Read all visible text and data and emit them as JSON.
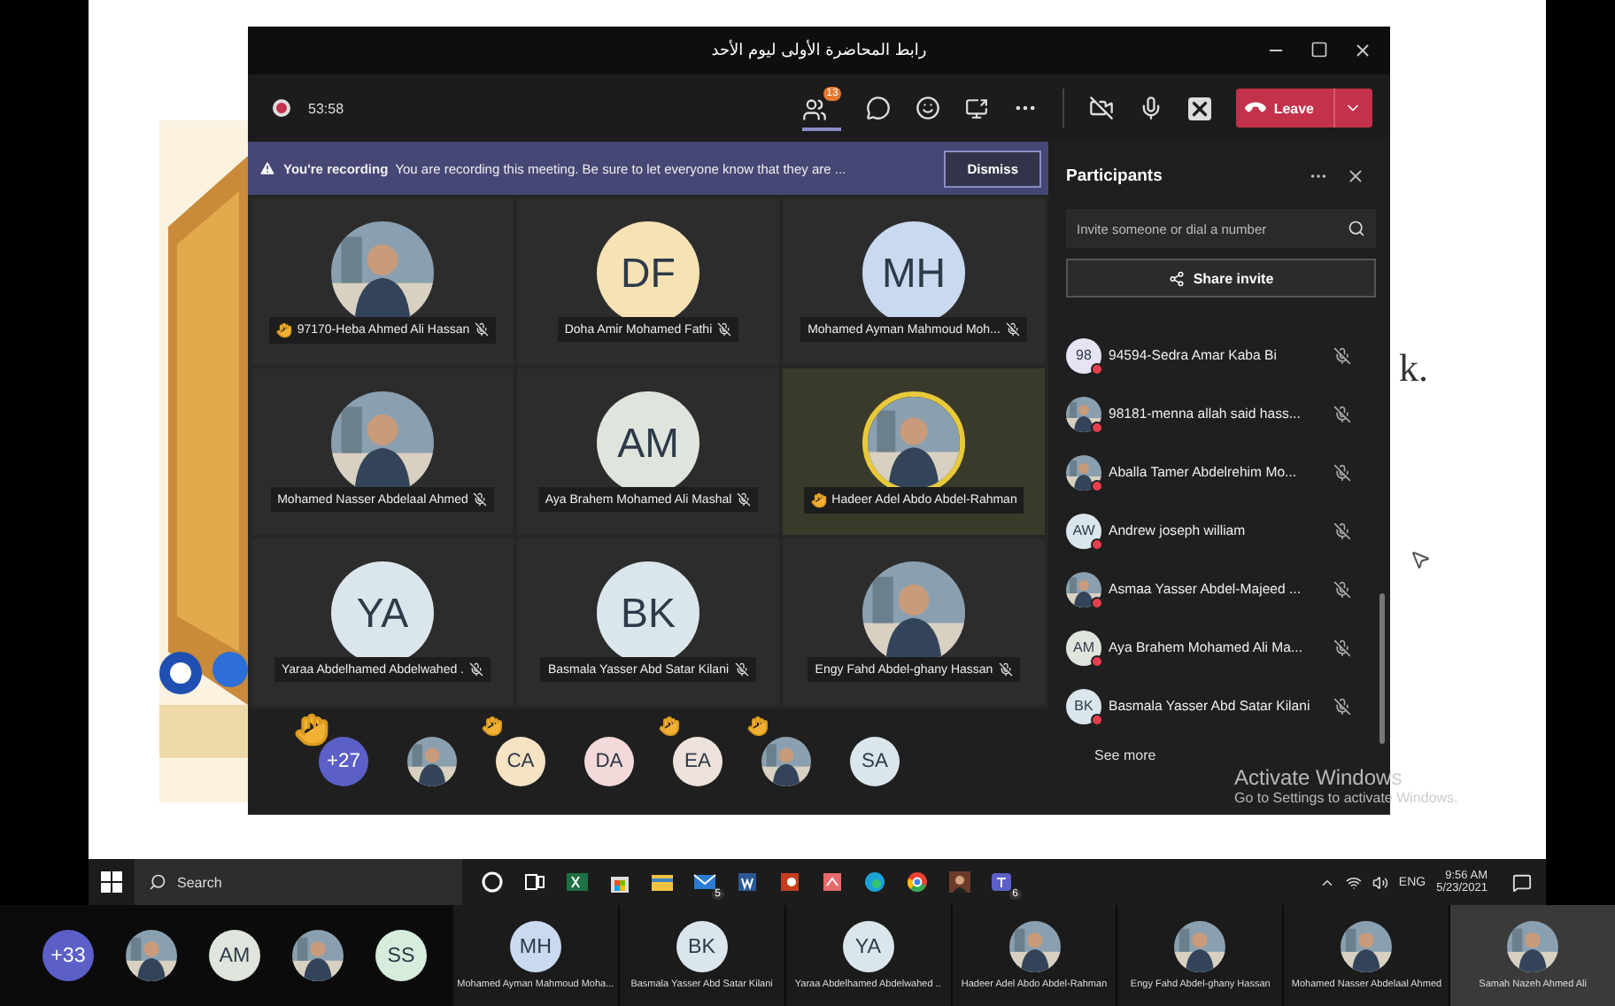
{
  "window": {
    "title": "رابط المحاضرة الأولى ليوم الأحد"
  },
  "meeting_bar": {
    "recording": true,
    "timer": "53:58",
    "participants_badge": "13",
    "camera_on": false,
    "leave_label": "Leave"
  },
  "recording_banner": {
    "title": "You're recording",
    "message": "You are recording this meeting. Be sure to let everyone know that they are ...",
    "dismiss": "Dismiss"
  },
  "tiles": [
    {
      "name": "97170-Heba Ahmed Ali Hassan",
      "kind": "picture",
      "hand_raised": true,
      "speaking": false,
      "muted": true
    },
    {
      "name": "Doha Amir Mohamed Fathi",
      "kind": "initials",
      "initials": "DF",
      "color": "#f6e2b3",
      "hand_raised": false,
      "speaking": false,
      "muted": true
    },
    {
      "name": "Mohamed Ayman Mahmoud Moh...",
      "kind": "initials",
      "initials": "MH",
      "color": "#c9d9ef",
      "hand_raised": false,
      "speaking": false,
      "muted": true
    },
    {
      "name": "Mohamed Nasser Abdelaal Ahmed",
      "kind": "picture",
      "hand_raised": false,
      "speaking": false,
      "muted": true
    },
    {
      "name": "Aya Brahem Mohamed Ali Mashal",
      "kind": "initials",
      "initials": "AM",
      "color": "#dfe5dc",
      "hand_raised": false,
      "speaking": false,
      "muted": true
    },
    {
      "name": "Hadeer Adel Abdo Abdel-Rahman",
      "kind": "picture",
      "hand_raised": true,
      "speaking": true,
      "muted": false
    },
    {
      "name": "Yaraa Abdelhamed Abdelwahed .",
      "kind": "initials",
      "initials": "YA",
      "color": "#dbe6ec",
      "hand_raised": false,
      "speaking": false,
      "muted": true
    },
    {
      "name": "Basmala Yasser Abd Satar Kilani",
      "kind": "initials",
      "initials": "BK",
      "color": "#dbe6ec",
      "hand_raised": false,
      "speaking": false,
      "muted": true
    },
    {
      "name": "Engy Fahd Abdel-ghany Hassan",
      "kind": "picture",
      "hand_raised": false,
      "speaking": false,
      "muted": true
    }
  ],
  "overflow_row": [
    {
      "kind": "count",
      "text": "+27",
      "hand_raised": true
    },
    {
      "kind": "picture",
      "hand_raised": false
    },
    {
      "kind": "initials",
      "initials": "CA",
      "color": "#f6e3c4",
      "hand_raised": true
    },
    {
      "kind": "initials",
      "initials": "DA",
      "color": "#f3d9d9",
      "hand_raised": false
    },
    {
      "kind": "initials",
      "initials": "EA",
      "color": "#eee3dc",
      "hand_raised": true
    },
    {
      "kind": "picture",
      "hand_raised": true
    },
    {
      "kind": "initials",
      "initials": "SA",
      "color": "#dbe6ec",
      "hand_raised": false
    }
  ],
  "participants_panel": {
    "title": "Participants",
    "invite_placeholder": "Invite someone or dial a number",
    "share_invite": "Share invite",
    "see_more": "See more",
    "people": [
      {
        "name": "94594-Sedra Amar Kaba Bi",
        "kind": "initials",
        "initials": "98",
        "color": "#e6e3f4"
      },
      {
        "name": "98181-menna allah said hass...",
        "kind": "picture"
      },
      {
        "name": "Aballa Tamer Abdelrehim Mo...",
        "kind": "picture"
      },
      {
        "name": "Andrew joseph william",
        "kind": "initials",
        "initials": "AW",
        "color": "#dbe6ec"
      },
      {
        "name": "Asmaa Yasser Abdel-Majeed ...",
        "kind": "picture"
      },
      {
        "name": "Aya Brahem Mohamed Ali Ma...",
        "kind": "initials",
        "initials": "AM",
        "color": "#dfe5dc"
      },
      {
        "name": "Basmala Yasser Abd Satar Kilani",
        "kind": "initials",
        "initials": "BK",
        "color": "#dbe6ec"
      }
    ]
  },
  "slide": {
    "fragment": "k."
  },
  "os_notice": {
    "title": "Activate Windows",
    "message": "Go to Settings to activate Windows."
  },
  "taskbar": {
    "search_placeholder": "Search",
    "apps": [
      {
        "kind": "cortana"
      },
      {
        "kind": "taskview"
      },
      {
        "kind": "spreadsheet"
      },
      {
        "kind": "store"
      },
      {
        "kind": "folder"
      },
      {
        "kind": "mail",
        "badge": "5"
      },
      {
        "kind": "document"
      },
      {
        "kind": "slides"
      },
      {
        "kind": "paint"
      },
      {
        "kind": "browser"
      },
      {
        "kind": "globe"
      },
      {
        "kind": "person"
      },
      {
        "kind": "teams",
        "badge": "6"
      }
    ],
    "language": "ENG",
    "time": "9:56 AM",
    "date": "5/23/2021"
  },
  "video_strip": {
    "items": [
      {
        "kind": "count",
        "text": "+33"
      },
      {
        "kind": "picture"
      },
      {
        "kind": "initials",
        "initials": "AM",
        "color": "#dfe5dc"
      },
      {
        "kind": "picture"
      },
      {
        "kind": "initials",
        "initials": "SS",
        "color": "#d6ecdc"
      }
    ],
    "tiles": [
      {
        "name": "Mohamed Ayman Mahmoud Moha...",
        "kind": "initials",
        "initials": "MH",
        "color": "#c9d9ef",
        "highlighted": false
      },
      {
        "name": "Basmala Yasser Abd Satar Kilani",
        "kind": "initials",
        "initials": "BK",
        "color": "#dbe6ec",
        "highlighted": false
      },
      {
        "name": "Yaraa Abdelhamed Abdelwahed ..",
        "kind": "initials",
        "initials": "YA",
        "color": "#dbe6ec",
        "highlighted": false
      },
      {
        "name": "Hadeer Adel Abdo Abdel-Rahman",
        "kind": "picture",
        "highlighted": false
      },
      {
        "name": "Engy Fahd Abdel-ghany Hassan",
        "kind": "picture",
        "highlighted": false
      },
      {
        "name": "Mohamed Nasser Abdelaal Ahmed",
        "kind": "picture",
        "highlighted": false
      },
      {
        "name": "Samah Nazeh Ahmed Ali",
        "kind": "picture",
        "highlighted": true
      }
    ]
  }
}
